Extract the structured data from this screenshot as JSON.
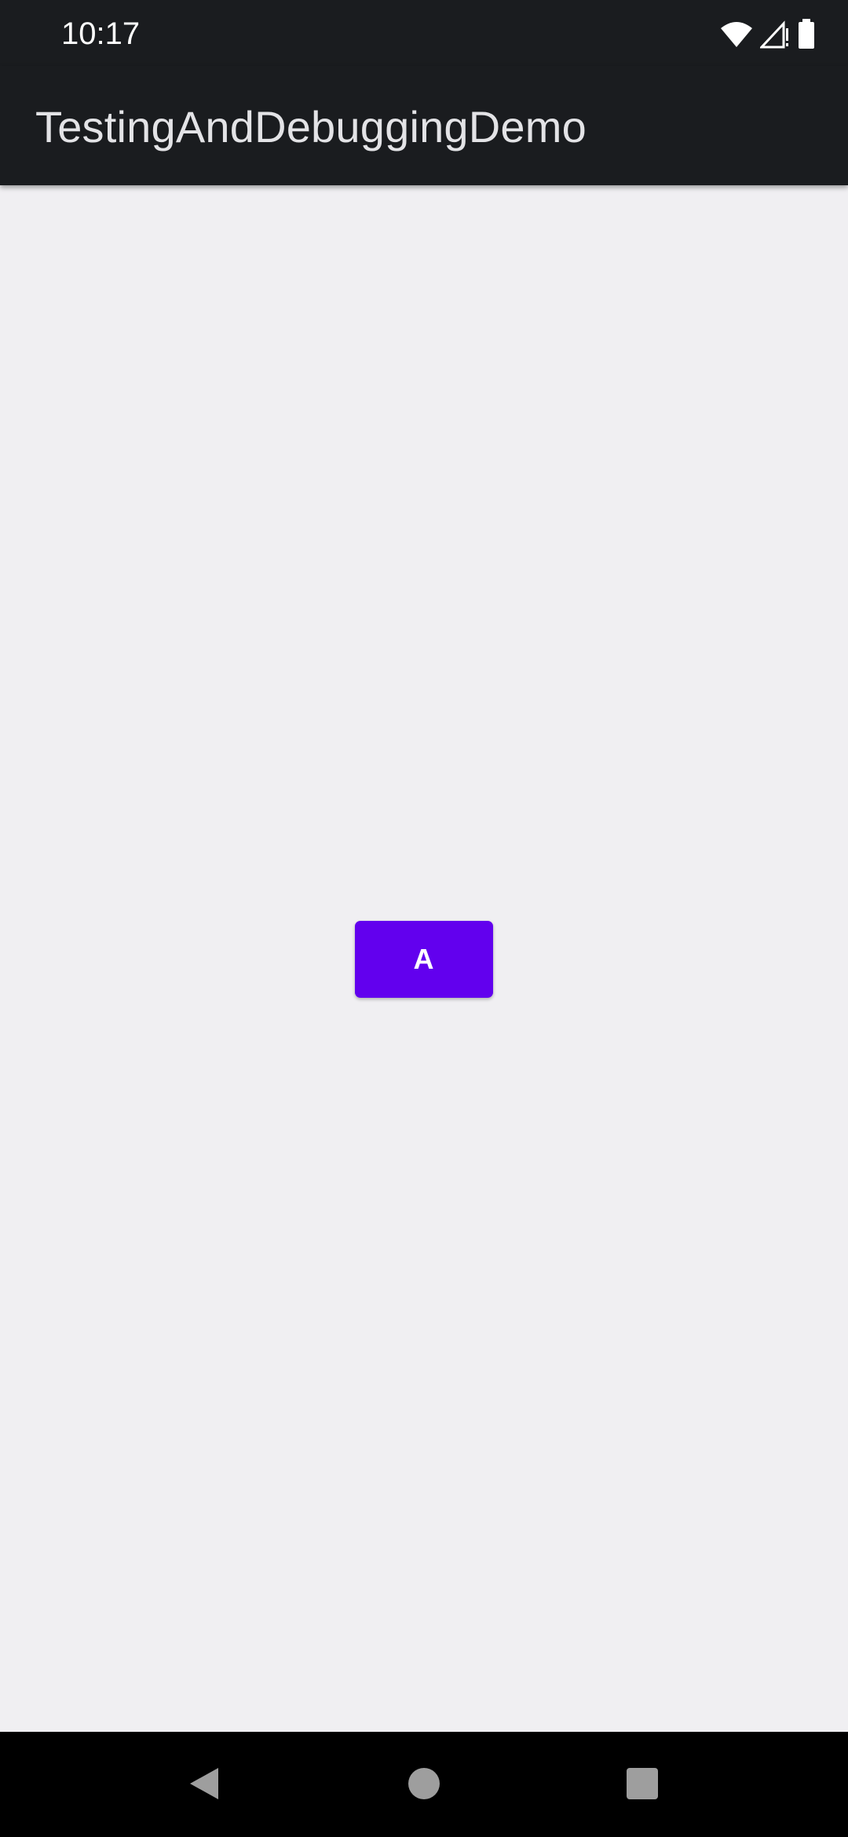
{
  "status_bar": {
    "time": "10:17",
    "icons": [
      "wifi-icon",
      "cell-signal-icon",
      "battery-icon"
    ]
  },
  "app_bar": {
    "title": "TestingAndDebuggingDemo"
  },
  "main": {
    "button_a_label": "A"
  },
  "nav_bar": {
    "icons": [
      "back-icon",
      "home-icon",
      "recents-icon"
    ]
  },
  "colors": {
    "app_bar_bg": "#1a1c1f",
    "content_bg": "#f0eff2",
    "button_bg": "#6200ee",
    "nav_bar_bg": "#000000"
  }
}
